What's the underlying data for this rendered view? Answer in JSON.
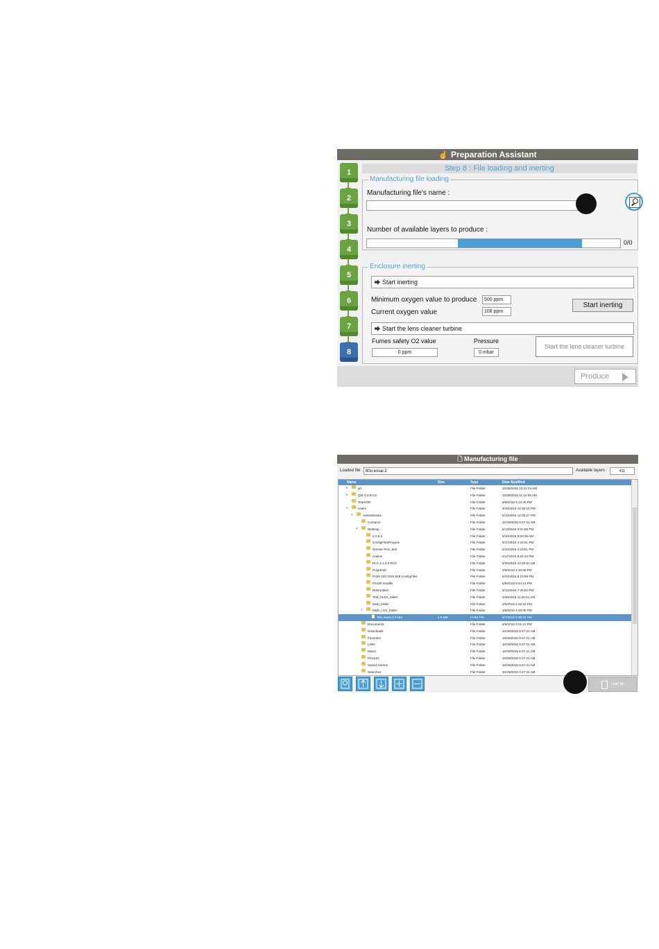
{
  "preparation_assistant": {
    "title": "Preparation Assistant",
    "step_header": "Step 8 : File loading and inerting",
    "steps": [
      "1",
      "2",
      "3",
      "4",
      "5",
      "6",
      "7",
      "8"
    ],
    "active_step": "8",
    "manufacturing_file_loading": {
      "legend": "Manufacturing file loading",
      "file_name_label": "Manufacturing file's name :",
      "file_name_value": "",
      "layers_label": "Number of available layers to produce :",
      "layers_counter": "0/0",
      "layers_bar_fill": {
        "start": 0.36,
        "end": 0.85
      }
    },
    "enclosure_inerting": {
      "legend": "Enclosure inerting",
      "start_inerting_cmd": "Start inerting",
      "min_oxygen_label": "Minimum oxygen value to produce",
      "min_oxygen_value": "500 ppm",
      "current_oxygen_label": "Current oxygen value",
      "current_oxygen_value": "108 ppm",
      "start_inerting_button": "Start inerting",
      "lens_cleaner_cmd": "Start the lens cleaner turbine",
      "fumes_label": "Fumes safety O2 value",
      "fumes_value": "0 ppm",
      "pressure_label": "Pressure",
      "pressure_value": "0 mbar",
      "lens_cleaner_button": "Start the lens cleaner turbine"
    },
    "produce_button": "Produce",
    "accent": "#4aa3d9",
    "step_color": "#6aa33f",
    "active_step_color": "#3b6fb0"
  },
  "manufacturing_file": {
    "title": "Manufacturing file",
    "loaded_file_label": "Loaded file :",
    "loaded_file_value": "80u essai 2",
    "available_layers_label": "Available layers :",
    "available_layers_value": "411",
    "columns": [
      "Name",
      "Size",
      "Type",
      "Date Modified"
    ],
    "rows": [
      {
        "name": "git",
        "size": "",
        "type": "File Folder",
        "date": "10/29/2015 10:41:24 AM",
        "indent": 1,
        "exp": "▸"
      },
      {
        "name": "Qt4 4.3.8-rc3",
        "size": "",
        "type": "File Folder",
        "date": "10/29/2015 11:12:06 AM",
        "indent": 1,
        "exp": "▸"
      },
      {
        "name": "TeamOIF",
        "size": "",
        "type": "File Folder",
        "date": "6/8/2016 3:13:40 PM",
        "indent": 1,
        "exp": ""
      },
      {
        "name": "Users",
        "size": "",
        "type": "File Folder",
        "date": "4/20/2015 12:36:15 PM",
        "indent": 1,
        "exp": "▾"
      },
      {
        "name": "Administrator",
        "size": "",
        "type": "File Folder",
        "date": "5/12/2016 12:03:27 PM",
        "indent": 2,
        "exp": "▾"
      },
      {
        "name": "Contacts",
        "size": "",
        "type": "File Folder",
        "date": "10/29/2015 8:47:21 AM",
        "indent": 3,
        "exp": ""
      },
      {
        "name": "Desktop",
        "size": "",
        "type": "File Folder",
        "date": "6/13/2016 3:01:59 PM",
        "indent": 3,
        "exp": "▾"
      },
      {
        "name": "2.0.9.2",
        "size": "",
        "type": "File Folder",
        "date": "5/10/2016 9:06:39 AM",
        "indent": 4,
        "exp": ""
      },
      {
        "name": "ConfigFilesProgres",
        "size": "",
        "type": "File Folder",
        "date": "5/17/2016 1:44:51 PM",
        "indent": 4,
        "exp": ""
      },
      {
        "name": "Dernier PAS_test",
        "size": "",
        "type": "File Folder",
        "date": "6/13/2016 4:23:51 PM",
        "indent": 4,
        "exp": ""
      },
      {
        "name": "Analos",
        "size": "",
        "type": "File Folder",
        "date": "2/17/2016 5:22:13 PM",
        "indent": 4,
        "exp": ""
      },
      {
        "name": "PLC 2.1.0.0 RC3",
        "size": "",
        "type": "File Folder",
        "date": "5/20/2016 10:20:51 AM",
        "indent": 4,
        "exp": ""
      },
      {
        "name": "ProjetFab",
        "size": "",
        "type": "File Folder",
        "date": "2/5/2016 4:10:50 PM",
        "indent": 4,
        "exp": ""
      },
      {
        "name": "ProM 100 2015.826 ConfigFiles",
        "size": "",
        "type": "File Folder",
        "date": "5/10/2016 5:23:09 PM",
        "indent": 4,
        "exp": ""
      },
      {
        "name": "PA100 modifie",
        "size": "",
        "type": "File Folder",
        "date": "5/9/2016 9:44:14 PM",
        "indent": 4,
        "exp": ""
      },
      {
        "name": "Restoration",
        "size": "",
        "type": "File Folder",
        "date": "5/12/2016 7:45:52 PM",
        "indent": 4,
        "exp": ""
      },
      {
        "name": "Test_FLEX_folder",
        "size": "",
        "type": "File Folder",
        "date": "3/30/2016 11:26:41 AM",
        "indent": 4,
        "exp": ""
      },
      {
        "name": "Multi_folder",
        "size": "",
        "type": "File Folder",
        "date": "2/5/2016 2:33:22 PM",
        "indent": 4,
        "exp": ""
      },
      {
        "name": "Multi_LGS_folder",
        "size": "",
        "type": "File Folder",
        "date": "2/8/2016 4:25:00 PM",
        "indent": 4,
        "exp": "▾"
      },
      {
        "name": "80u essai 2.FAB3",
        "size": "2.9 MB",
        "type": "FAB3 File",
        "date": "6/1/2016 5:36:34 PM",
        "indent": 5,
        "exp": "",
        "selected": true
      },
      {
        "name": "Documents",
        "size": "",
        "type": "File Folder",
        "date": "6/8/2016 2:01:21 PM",
        "indent": 3,
        "exp": ""
      },
      {
        "name": "Downloads",
        "size": "",
        "type": "File Folder",
        "date": "10/29/2015 8:47:21 AM",
        "indent": 3,
        "exp": ""
      },
      {
        "name": "Favorites",
        "size": "",
        "type": "File Folder",
        "date": "10/29/2015 8:47:21 AM",
        "indent": 3,
        "exp": ""
      },
      {
        "name": "Links",
        "size": "",
        "type": "File Folder",
        "date": "10/29/2015 8:47:21 AM",
        "indent": 3,
        "exp": ""
      },
      {
        "name": "Music",
        "size": "",
        "type": "File Folder",
        "date": "10/29/2015 8:47:21 AM",
        "indent": 3,
        "exp": ""
      },
      {
        "name": "Pictures",
        "size": "",
        "type": "File Folder",
        "date": "10/29/2015 8:47:21 AM",
        "indent": 3,
        "exp": ""
      },
      {
        "name": "Saved Games",
        "size": "",
        "type": "File Folder",
        "date": "10/29/2015 8:47:21 AM",
        "indent": 3,
        "exp": ""
      },
      {
        "name": "Searches",
        "size": "",
        "type": "File Folder",
        "date": "10/29/2015 8:47:21 AM",
        "indent": 3,
        "exp": ""
      }
    ],
    "toolbar_icons": [
      "drive-icon",
      "arrow-up-icon",
      "arrow-down-icon",
      "expand-icon",
      "collapse-icon"
    ],
    "load_file_button": "Load file",
    "header_color": "#5b95c8"
  }
}
